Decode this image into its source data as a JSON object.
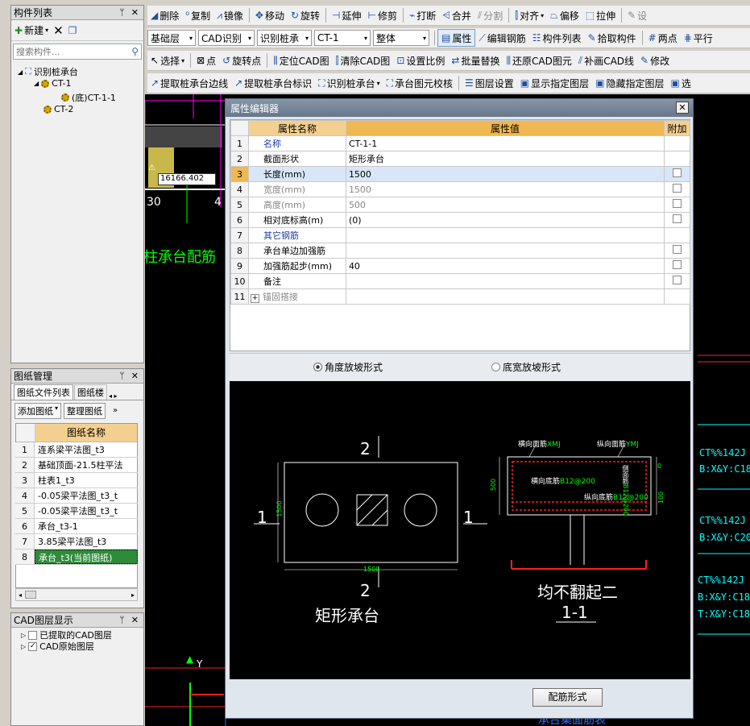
{
  "component_list": {
    "title": "构件列表",
    "new_label": "新建",
    "search_placeholder": "搜索构件...",
    "tree": {
      "root": "识别桩承台",
      "item1": "CT-1",
      "item1_child": "(底)CT-1-1",
      "item2": "CT-2"
    }
  },
  "sheet_panel": {
    "title": "图纸管理",
    "tab1": "图纸文件列表",
    "tab2": "图纸楼",
    "add_button": "添加图纸",
    "organize_button": "整理图纸",
    "col_header": "图纸名称",
    "rows": [
      {
        "n": "1",
        "name": "连系梁平法图_t3"
      },
      {
        "n": "2",
        "name": "基础顶面-21.5柱平法"
      },
      {
        "n": "3",
        "name": "柱表1_t3"
      },
      {
        "n": "4",
        "name": "-0.05梁平法图_t3_t"
      },
      {
        "n": "5",
        "name": "-0.05梁平法图_t3_t"
      },
      {
        "n": "6",
        "name": "承台_t3-1"
      },
      {
        "n": "7",
        "name": "3.85梁平法图_t3"
      },
      {
        "n": "8",
        "name": "承台_t3(当前图纸)"
      }
    ]
  },
  "cad_layer_panel": {
    "title": "CAD图层显示",
    "item1": "已提取的CAD图层",
    "item2": "CAD原始图层"
  },
  "toolbar1": {
    "delete": "删除",
    "copy": "复制",
    "mirror": "镜像",
    "move": "移动",
    "rotate": "旋转",
    "extend": "延伸",
    "trim": "修剪",
    "break": "打断",
    "merge": "合并",
    "split": "分割",
    "align": "对齐",
    "offset": "偏移",
    "stretch": "拉伸",
    "set": "设"
  },
  "toolbar2": {
    "floor": "基础层",
    "cad_recognize": "CAD识别",
    "recognize_pile": "识别桩承",
    "component": "CT-1",
    "whole": "整体",
    "property": "属性",
    "edit_rebar": "编辑钢筋",
    "component_list": "构件列表",
    "pick_component": "拾取构件",
    "two_points": "两点",
    "parallel": "平行"
  },
  "toolbar3": {
    "select": "选择",
    "point": "点",
    "rotate_point": "旋转点",
    "locate_cad": "定位CAD图",
    "clear_cad": "清除CAD图",
    "set_scale": "设置比例",
    "batch_replace": "批量替换",
    "restore_cad": "还原CAD图元",
    "supplement_cad": "补画CAD线",
    "modify": "修改"
  },
  "toolbar4": {
    "extract_edge": "提取桩承台边线",
    "extract_label": "提取桩承台标识",
    "recognize_pile_cap": "识别桩承台",
    "check_pile_cap": "承台图元校核",
    "layer_settings": "图层设置",
    "show_layer": "显示指定图层",
    "hide_layer": "隐藏指定图层",
    "more": "选"
  },
  "cad_canvas": {
    "coord_input": "16166.402",
    "num_30": "30",
    "num_4": "4",
    "label_pile": "柱承台配筋",
    "ct_text_1": "CT%%142J",
    "ct_text_1b": "B:X&Y:C18",
    "ct_text_2": "CT%%142J",
    "ct_text_2b": "B:X&Y:C20",
    "ct_text_3": "CT%%142J",
    "ct_text_3b": "B:X&Y:C18",
    "ct_text_3c": "T:X&Y:C18",
    "axis_y": "Y",
    "bottom_text": "承台集面筋表"
  },
  "property_editor": {
    "title": "属性编辑器",
    "col_name": "属性名称",
    "col_value": "属性值",
    "col_extra": "附加",
    "rows": [
      {
        "n": "1",
        "name": "名称",
        "value": "CT-1-1"
      },
      {
        "n": "2",
        "name": "截面形状",
        "value": "矩形承台"
      },
      {
        "n": "3",
        "name": "长度(mm)",
        "value": "1500"
      },
      {
        "n": "4",
        "name": "宽度(mm)",
        "value": "1500"
      },
      {
        "n": "5",
        "name": "高度(mm)",
        "value": "500"
      },
      {
        "n": "6",
        "name": "相对底标高(m)",
        "value": "(0)"
      },
      {
        "n": "7",
        "name": "其它钢筋",
        "value": ""
      },
      {
        "n": "8",
        "name": "承台单边加强筋",
        "value": ""
      },
      {
        "n": "9",
        "name": "加强筋起步(mm)",
        "value": "40"
      },
      {
        "n": "10",
        "name": "备注",
        "value": ""
      },
      {
        "n": "11",
        "name": "锚固搭接",
        "value": ""
      }
    ],
    "radio1": "角度放坡形式",
    "radio2": "底宽放坡形式",
    "rebar_button": "配筋形式"
  },
  "preview": {
    "section_mark": "2",
    "side_mark": "1",
    "dim_len": "1500",
    "dim_width": "1500",
    "caption": "矩形承台",
    "top_rebar_h": "横向面筋",
    "top_rebar_h_val": "XMJ",
    "top_rebar_v": "纵向面筋",
    "top_rebar_v_val": "YMJ",
    "bottom_rebar_h": "横向底筋",
    "bottom_rebar_h_val": "B12@200",
    "bottom_rebar_v": "纵向底筋",
    "bottom_rebar_v_val": "B12@200",
    "side_rebar": "侧面筋",
    "side_rebar_val": "B12@200",
    "dim_height": "500",
    "dim_cover": "100",
    "dim_zero": "0",
    "section_caption": "均不翻起二",
    "section_label": "1-1"
  }
}
